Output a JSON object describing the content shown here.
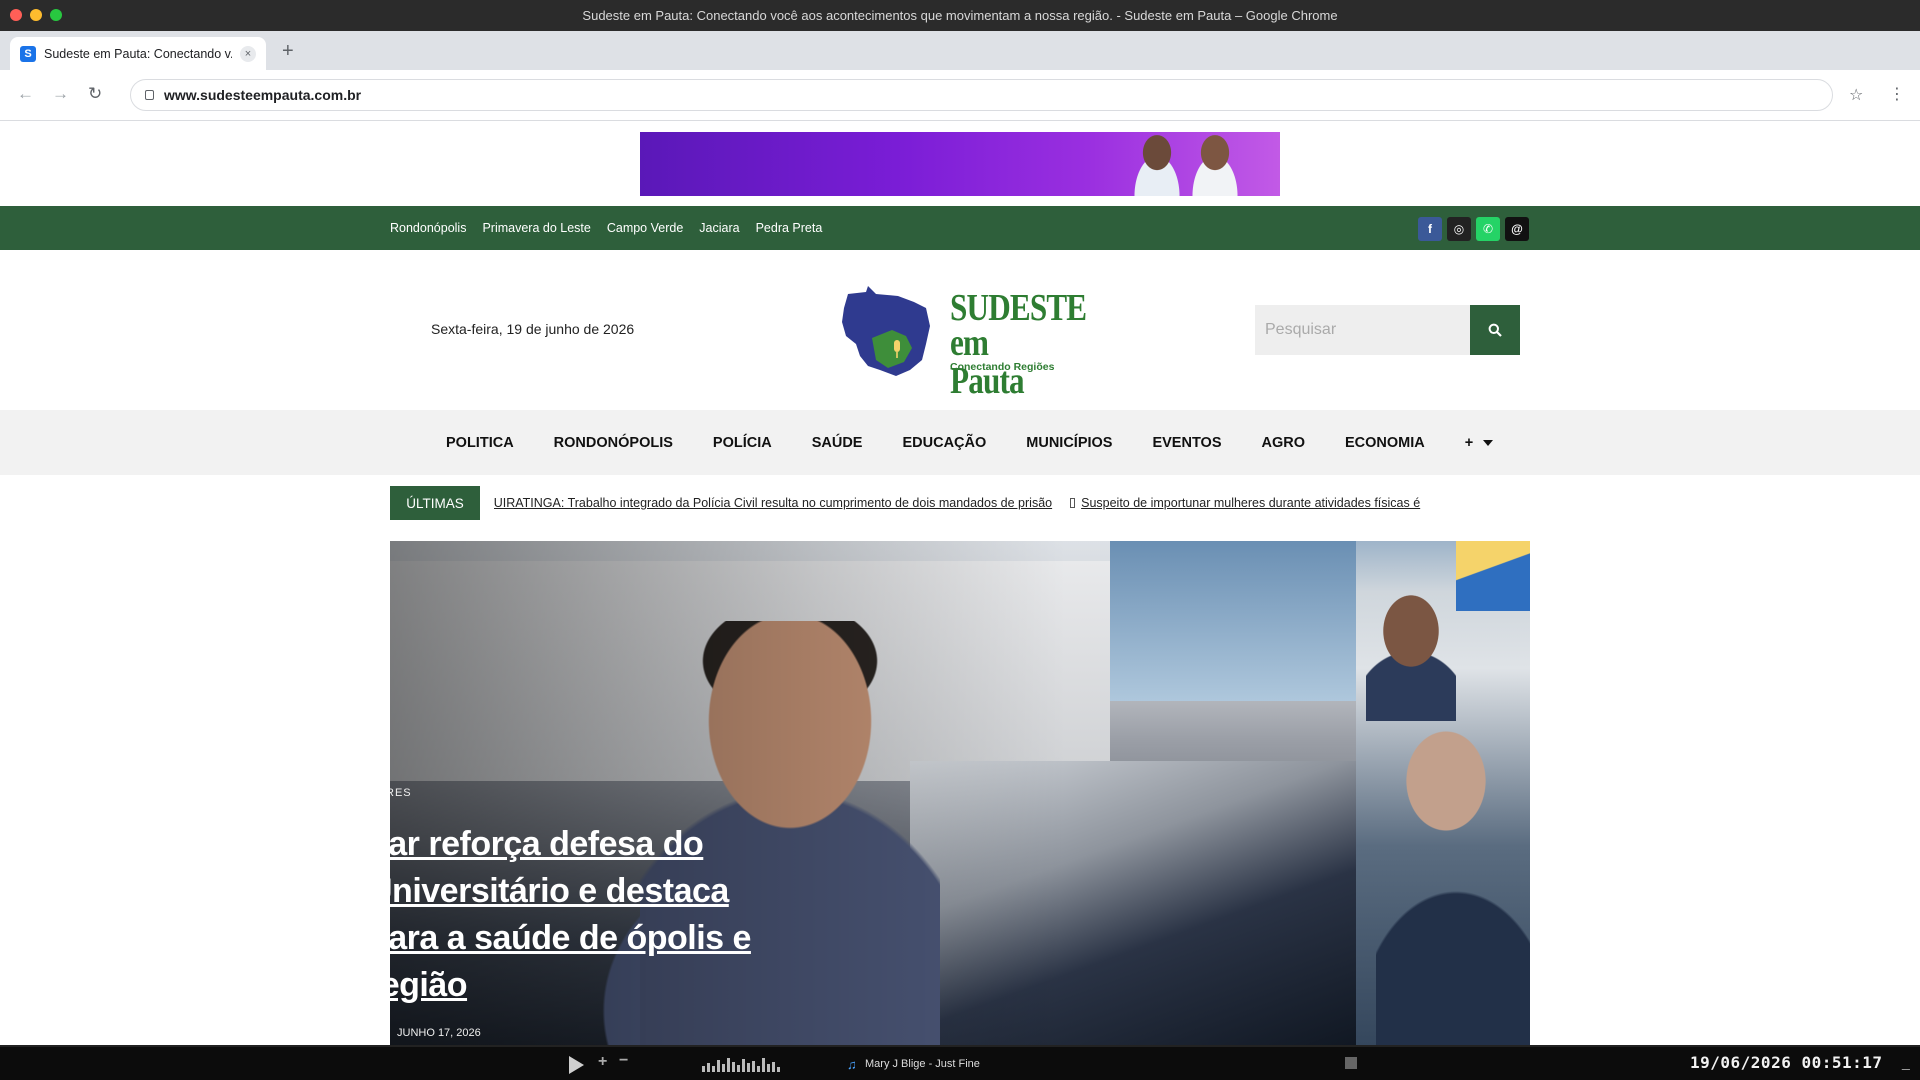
{
  "window": {
    "title": "Sudeste em Pauta: Conectando você aos acontecimentos que movimentam a nossa região. - Sudeste em Pauta – Google Chrome"
  },
  "tab": {
    "favicon_letter": "S",
    "title": "Sudeste em Pauta: Conectando v...",
    "close": "×",
    "new_tab": "+"
  },
  "toolbar": {
    "back": "←",
    "forward": "→",
    "reload": "↻",
    "url": "www.sudesteempauta.com.br",
    "star": "☆",
    "menu": "⋮"
  },
  "topbar": {
    "cities": [
      "Rondonópolis",
      "Primavera do Leste",
      "Campo Verde",
      "Jaciara",
      "Pedra Preta"
    ],
    "socials": [
      {
        "name": "facebook-icon",
        "glyph": "f"
      },
      {
        "name": "instagram-icon",
        "glyph": "◎"
      },
      {
        "name": "whatsapp-icon",
        "glyph": "✆"
      },
      {
        "name": "threads-icon",
        "glyph": "@"
      }
    ]
  },
  "header": {
    "date": "Sexta-feira, 19 de junho de 2026",
    "logo_line1": "SUDESTE",
    "logo_line2": "em Pauta",
    "logo_tagline": "Conectando Regiões",
    "search_placeholder": "Pesquisar"
  },
  "nav": {
    "items": [
      "POLITICA",
      "RONDONÓPOLIS",
      "POLÍCIA",
      "SAÚDE",
      "EDUCAÇÃO",
      "MUNICÍPIOS",
      "EVENTOS",
      "AGRO",
      "ECONOMIA"
    ],
    "more": "+"
  },
  "ticker": {
    "label": "ÚLTIMAS",
    "items": [
      "GUIRATINGA: Trabalho integrado da Polícia Civil resulta no cumprimento de dois mandados de prisão",
      "Suspeito de importunar mulheres durante atividades físicas é"
    ]
  },
  "hero": {
    "category": "RES",
    "title": "nar reforça defesa do Universitário e destaca para a saúde de ópolis e região",
    "date": "JUNHO 17, 2026"
  },
  "osbar": {
    "song": "Mary J Blige - Just Fine",
    "clock": "19/06/2026 00:51:17",
    "eq_levels": [
      0.35,
      0.55,
      0.4,
      0.75,
      0.5,
      0.9,
      0.6,
      0.45,
      0.8,
      0.55,
      0.7,
      0.4,
      0.85,
      0.5,
      0.65,
      0.3
    ]
  },
  "colors": {
    "brand_green": "#2e5f3b",
    "logo_green": "#2e7d32",
    "logo_blue": "#2f3a8f"
  }
}
